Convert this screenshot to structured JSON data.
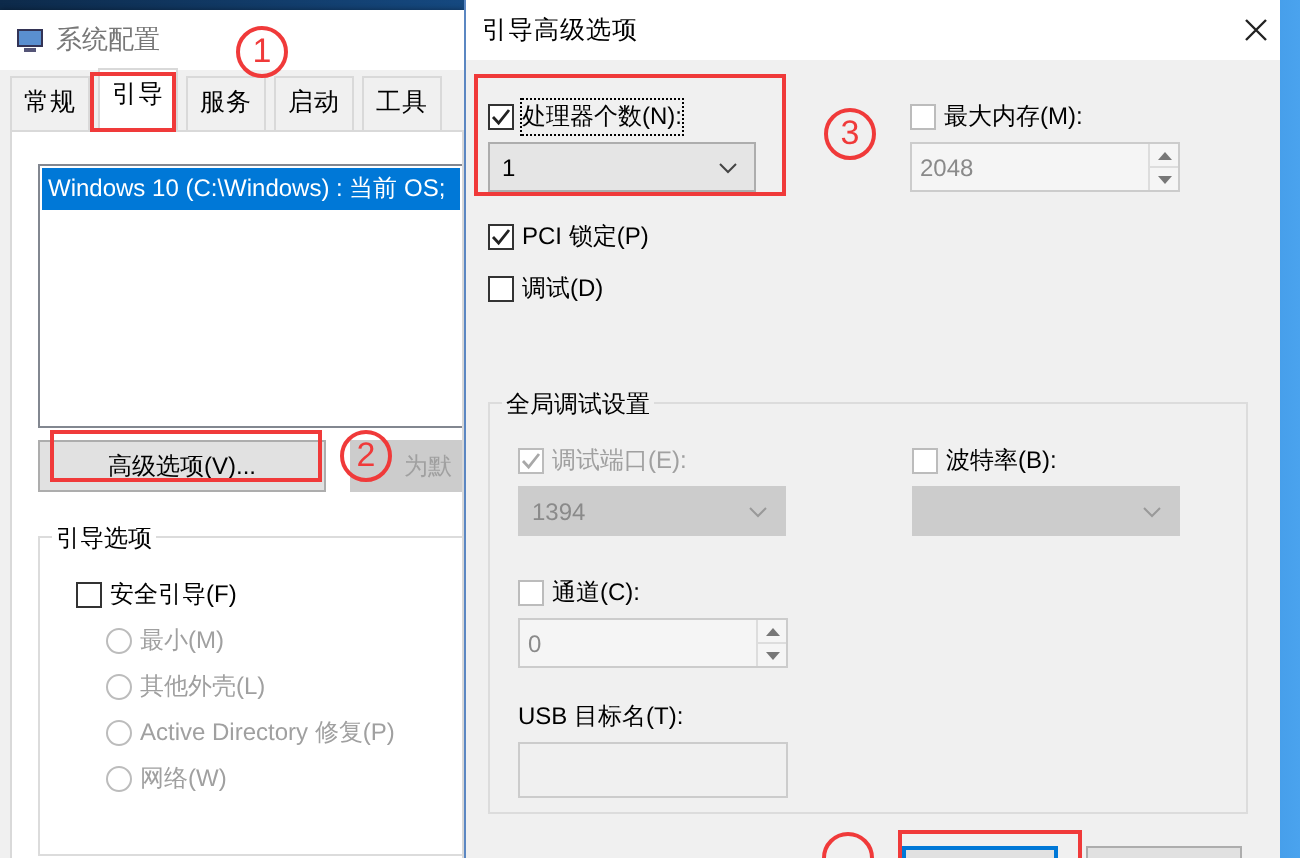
{
  "background_window": {
    "title": "系统配置",
    "tabs": [
      {
        "label": "常规",
        "selected": false
      },
      {
        "label": "引导",
        "selected": true
      },
      {
        "label": "服务",
        "selected": false
      },
      {
        "label": "启动",
        "selected": false
      },
      {
        "label": "工具",
        "selected": false
      }
    ],
    "boot_list": [
      {
        "text": "Windows 10 (C:\\Windows) : 当前 OS;",
        "selected": true
      }
    ],
    "buttons": [
      {
        "label": "高级选项(V)...",
        "disabled": false
      },
      {
        "label": "为默",
        "disabled": true
      }
    ],
    "boot_options": {
      "title": "引导选项",
      "safe_boot": {
        "label": "安全引导(F)",
        "checked": false
      },
      "modes": [
        {
          "label": "最小(M)",
          "selected": false,
          "disabled": true
        },
        {
          "label": "其他外壳(L)",
          "selected": false,
          "disabled": true
        },
        {
          "label": "Active Directory 修复(P)",
          "selected": false,
          "disabled": true
        },
        {
          "label": "网络(W)",
          "selected": false,
          "disabled": true
        }
      ]
    }
  },
  "dialog": {
    "title": "引导高级选项",
    "processor_count": {
      "label": "处理器个数(N):",
      "checked": true,
      "focused": true,
      "value": "1"
    },
    "max_memory": {
      "label": "最大内存(M):",
      "checked": false,
      "disabled": true,
      "value": "2048"
    },
    "pci_lock": {
      "label": "PCI 锁定(P)",
      "checked": true
    },
    "debug": {
      "label": "调试(D)",
      "checked": false
    },
    "global_debug": {
      "title": "全局调试设置",
      "debug_port": {
        "label": "调试端口(E):",
        "checked": true,
        "disabled": true,
        "value": "1394"
      },
      "baud_rate": {
        "label": "波特率(B):",
        "checked": false,
        "disabled": true
      },
      "channel": {
        "label": "通道(C):",
        "checked": false,
        "disabled": true,
        "value": "0"
      },
      "usb_target": {
        "label": "USB 目标名(T):",
        "disabled": true
      }
    },
    "buttons": [
      {
        "default": true
      },
      {
        "default": false
      }
    ]
  },
  "callouts": [
    {
      "label": "1",
      "clipped": false
    },
    {
      "label": "2",
      "clipped": false
    },
    {
      "label": "3",
      "clipped": false
    },
    {
      "clipped": true
    }
  ]
}
